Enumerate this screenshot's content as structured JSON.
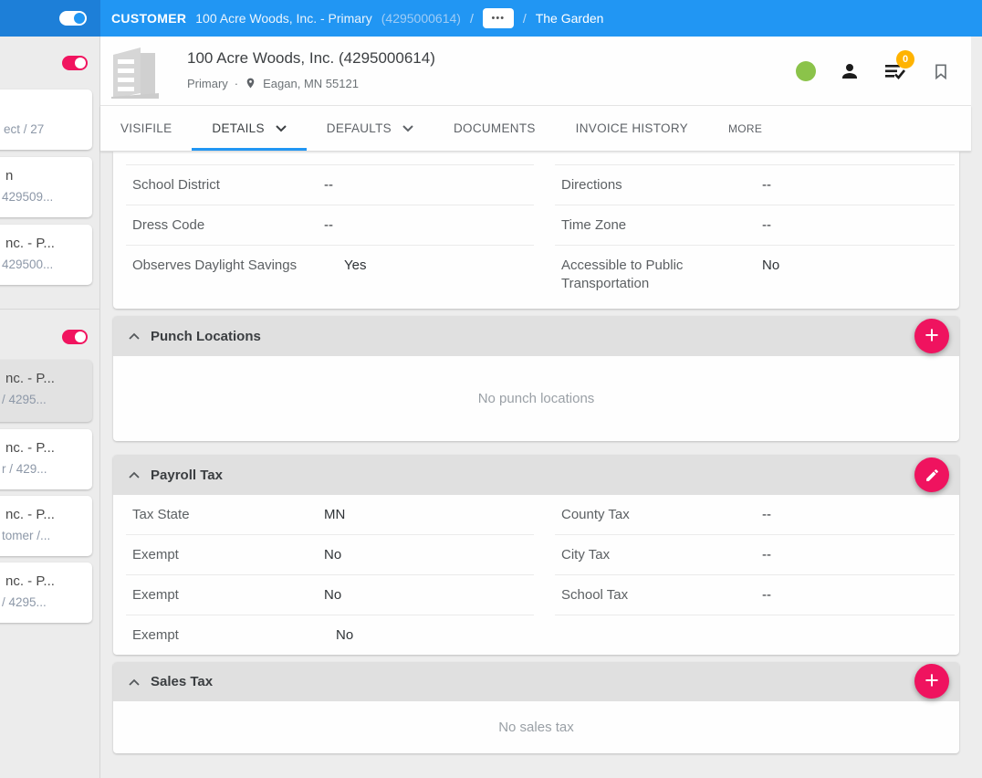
{
  "colors": {
    "topbar_blue": "#2196f3",
    "accent_pink": "#ef135f",
    "active_tab_blue": "#2196f3",
    "status_green": "#8bc34a",
    "badge_amber": "#ffb300",
    "section_header_gray": "#e0e0e0"
  },
  "icons": {
    "plus": "+",
    "ellipsis": "•••",
    "dot_separator": "·"
  },
  "topbar": {
    "entity_type": "CUSTOMER",
    "entity_name": "100 Acre Woods, Inc. - Primary",
    "entity_id": "(4295000614)",
    "separator": "/",
    "current_page": "The Garden"
  },
  "header": {
    "title": "100 Acre Woods, Inc. (4295000614)",
    "record_type": "Primary",
    "location": "Eagan, MN 55121",
    "badge_count": "0"
  },
  "tabs": {
    "items": [
      {
        "label": "VISIFILE"
      },
      {
        "label": "DETAILS"
      },
      {
        "label": "DEFAULTS"
      },
      {
        "label": "DOCUMENTS"
      },
      {
        "label": "INVOICE HISTORY"
      },
      {
        "label": "MORE"
      }
    ]
  },
  "details": {
    "left_rows": [
      {
        "label": "School District",
        "value": "--"
      },
      {
        "label": "Dress Code",
        "value": "--"
      },
      {
        "label": "Observes Daylight Savings",
        "value": "Yes"
      }
    ],
    "right_rows": [
      {
        "label": "Directions",
        "value": "--"
      },
      {
        "label": "Time Zone",
        "value": "--"
      },
      {
        "label": "Accessible to Public Transportation",
        "value": "No"
      }
    ]
  },
  "punch_locations": {
    "title": "Punch Locations",
    "empty_message": "No punch locations"
  },
  "payroll_tax": {
    "title": "Payroll Tax",
    "left_rows": [
      {
        "label": "Tax State",
        "value": "MN"
      },
      {
        "label": "Exempt",
        "value": "No"
      },
      {
        "label": "Exempt",
        "value": "No"
      },
      {
        "label": "Exempt",
        "value": "No"
      }
    ],
    "right_rows": [
      {
        "label": "County Tax",
        "value": "--"
      },
      {
        "label": "City Tax",
        "value": "--"
      },
      {
        "label": "School Tax",
        "value": "--"
      }
    ]
  },
  "sales_tax": {
    "title": "Sales Tax",
    "empty_message": "No sales tax"
  },
  "sidebar": {
    "counter_text": "ect / 27",
    "cards": [
      {
        "line1": "n",
        "line2": "429509..."
      },
      {
        "line1": "nc. - P...",
        "line2": "429500..."
      },
      {
        "line1": "nc. - P...",
        "line2": "/ 4295..."
      },
      {
        "line1": "nc. - P...",
        "line2": "r / 429..."
      },
      {
        "line1": "nc. - P...",
        "line2": "tomer /..."
      },
      {
        "line1": "nc. - P...",
        "line2": "/ 4295..."
      }
    ]
  }
}
